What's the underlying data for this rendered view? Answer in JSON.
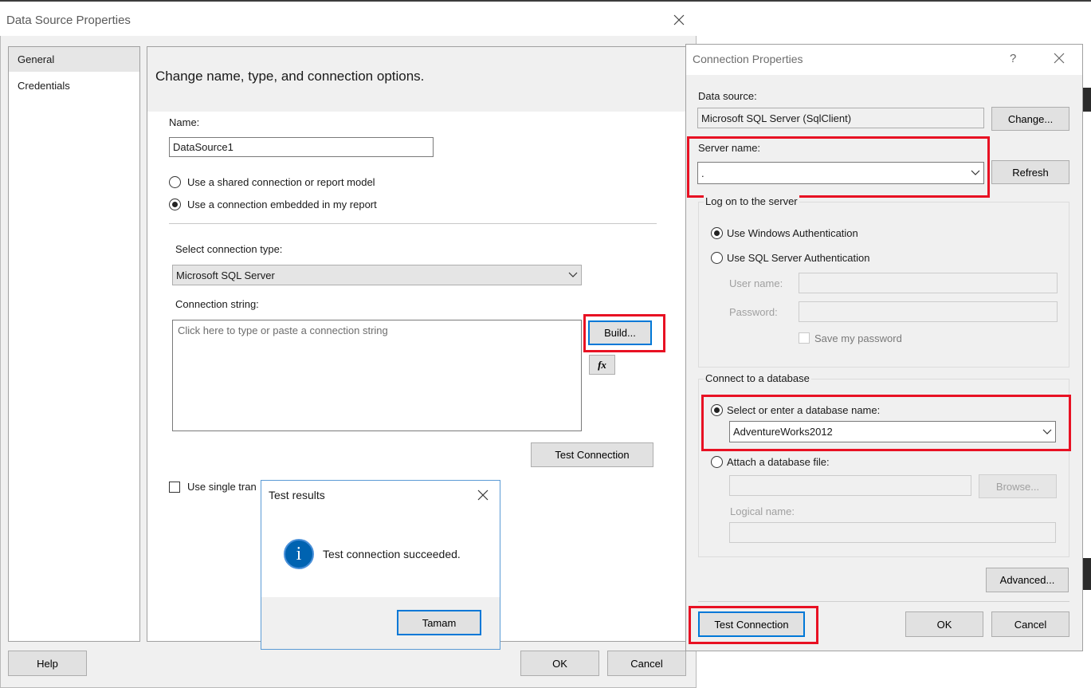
{
  "background_strips": {
    "right_edge_colors": [
      "#2b2b2b",
      "#f3f3f3"
    ]
  },
  "data_source_dialog": {
    "title": "Data Source Properties",
    "sidebar": {
      "items": [
        "General",
        "Credentials"
      ]
    },
    "header": "Change name, type, and connection options.",
    "name_label": "Name:",
    "name_value": "DataSource1",
    "radio_shared": "Use a shared connection or report model",
    "radio_embedded": "Use a connection embedded in my report",
    "connection_type_label": "Select connection type:",
    "connection_type_value": "Microsoft SQL Server",
    "connection_string_label": "Connection string:",
    "connection_string_placeholder": "Click here to type or paste a connection string",
    "build_button": "Build...",
    "fx_button": "fx",
    "test_connection_button": "Test Connection",
    "single_transaction_label": "Use single tran",
    "help_button": "Help",
    "ok_button": "OK",
    "cancel_button": "Cancel"
  },
  "test_results_dialog": {
    "title": "Test results",
    "message": "Test connection succeeded.",
    "ok_button": "Tamam",
    "icon": "info-icon"
  },
  "connection_properties_dialog": {
    "title": "Connection Properties",
    "help_glyph": "?",
    "data_source_label": "Data source:",
    "data_source_value": "Microsoft SQL Server (SqlClient)",
    "change_button": "Change...",
    "server_name_label": "Server name:",
    "server_name_value": ".",
    "refresh_button": "Refresh",
    "logon_group": "Log on to the server",
    "windows_auth": "Use Windows Authentication",
    "sql_auth": "Use SQL Server Authentication",
    "username_label": "User name:",
    "password_label": "Password:",
    "save_password": "Save my password",
    "connect_group": "Connect to a database",
    "select_db_label": "Select or enter a database name:",
    "database_value": "AdventureWorks2012",
    "attach_db_label": "Attach a database file:",
    "browse_button": "Browse...",
    "logical_name_label": "Logical name:",
    "advanced_button": "Advanced...",
    "test_connection_button": "Test Connection",
    "ok_button": "OK",
    "cancel_button": "Cancel"
  },
  "colors": {
    "highlight_red": "#e81123",
    "accent_blue": "#0078d7",
    "info_icon_blue": "#0063b1"
  }
}
